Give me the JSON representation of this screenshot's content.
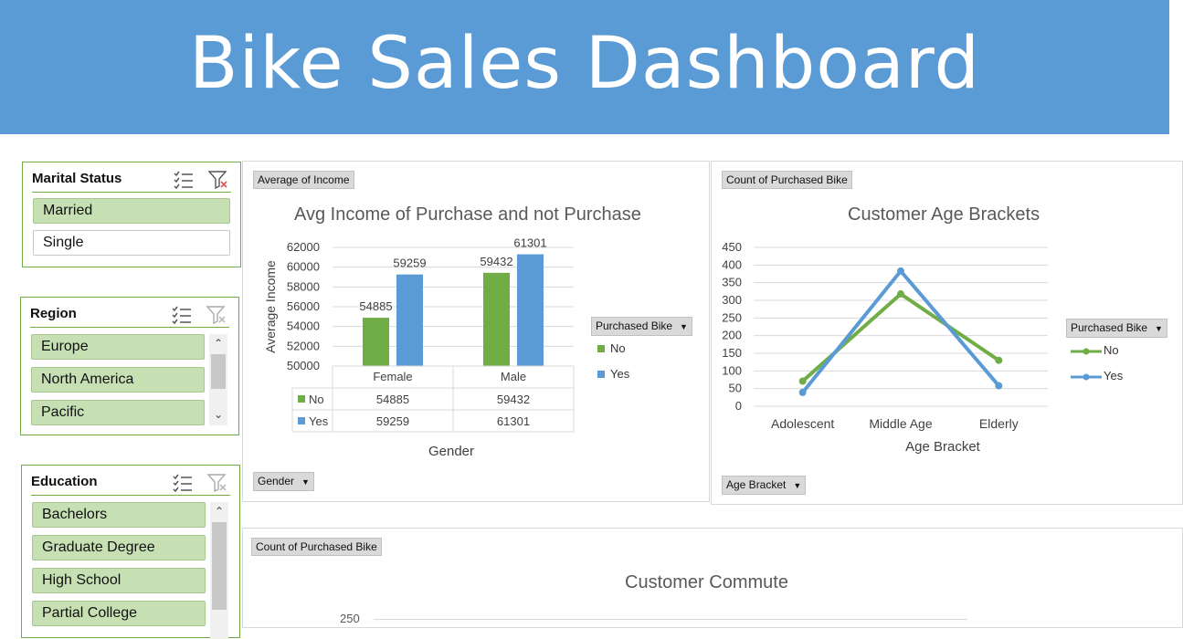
{
  "banner": {
    "title": "Bike Sales Dashboard"
  },
  "slicers": {
    "marital": {
      "title": "Marital Status",
      "items": [
        {
          "label": "Married",
          "selected": true
        },
        {
          "label": "Single",
          "selected": false
        }
      ]
    },
    "region": {
      "title": "Region",
      "items": [
        {
          "label": "Europe",
          "selected": true
        },
        {
          "label": "North America",
          "selected": true
        },
        {
          "label": "Pacific",
          "selected": true
        }
      ]
    },
    "education": {
      "title": "Education",
      "items": [
        {
          "label": "Bachelors",
          "selected": true
        },
        {
          "label": "Graduate Degree",
          "selected": true
        },
        {
          "label": "High School",
          "selected": true
        },
        {
          "label": "Partial College",
          "selected": true
        }
      ]
    }
  },
  "colors": {
    "no": "#70ad47",
    "yes": "#5b9bd5",
    "banner": "#5b9bd5",
    "slicer_selected": "#c6e0b4"
  },
  "income_chart": {
    "value_field": "Average of Income",
    "axis_field": "Gender",
    "legend_field": "Purchased Bike",
    "legend": [
      "No",
      "Yes"
    ],
    "chart_data": {
      "type": "bar",
      "title": "Avg Income of Purchase and not Purchase",
      "xlabel": "Gender",
      "ylabel": "Average Income",
      "categories": [
        "Female",
        "Male"
      ],
      "series": [
        {
          "name": "No",
          "values": [
            54885,
            59432
          ]
        },
        {
          "name": "Yes",
          "values": [
            59259,
            61301
          ]
        }
      ],
      "ylim": [
        50000,
        62000
      ],
      "yticks": [
        "62000",
        "60000",
        "58000",
        "56000",
        "54000",
        "52000",
        "50000"
      ],
      "data_table": true
    }
  },
  "age_chart": {
    "value_field": "Count of Purchased Bike",
    "axis_field": "Age Bracket",
    "legend_field": "Purchased Bike",
    "legend": [
      "No",
      "Yes"
    ],
    "chart_data": {
      "type": "line",
      "title": "Customer Age Brackets",
      "xlabel": "Age Bracket",
      "ylabel": "",
      "categories": [
        "Adolescent",
        "Middle Age",
        "Elderly"
      ],
      "series": [
        {
          "name": "No",
          "values": [
            71,
            318,
            130
          ]
        },
        {
          "name": "Yes",
          "values": [
            39,
            383,
            58
          ]
        }
      ],
      "ylim": [
        0,
        450
      ],
      "yticks": [
        "450",
        "400",
        "350",
        "300",
        "250",
        "200",
        "150",
        "100",
        "50",
        "0"
      ]
    }
  },
  "commute_chart": {
    "value_field": "Count of Purchased Bike",
    "chart_data": {
      "type": "bar",
      "title": "Customer Commute",
      "yticks_visible": [
        "250"
      ]
    }
  }
}
